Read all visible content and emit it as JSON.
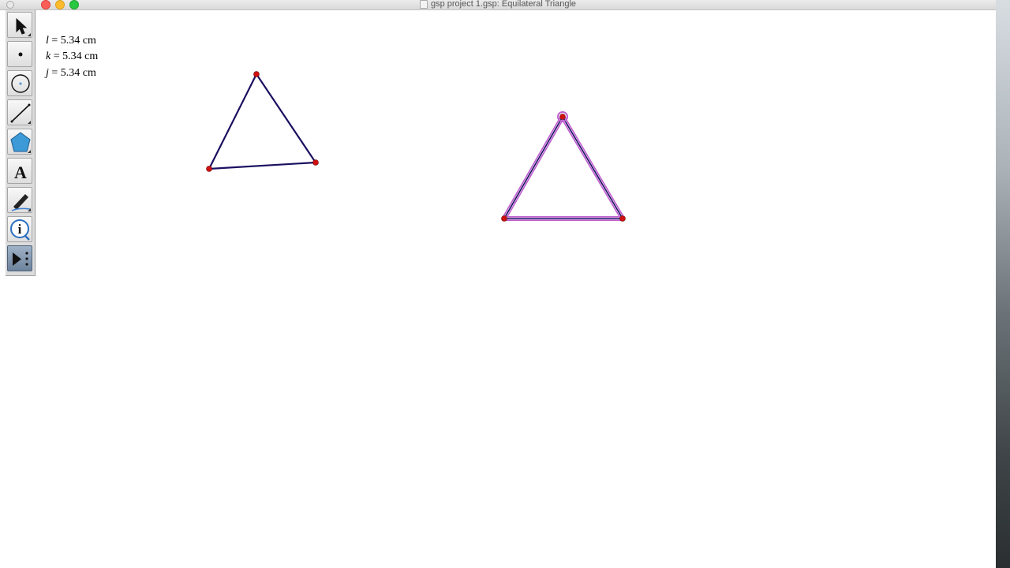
{
  "window": {
    "title": "gsp project 1.gsp: Equilateral Triangle"
  },
  "toolbox": {
    "tools": [
      {
        "name": "arrow-tool",
        "icon": "arrow-icon"
      },
      {
        "name": "point-tool",
        "icon": "point-icon"
      },
      {
        "name": "compass-tool",
        "icon": "circle-icon"
      },
      {
        "name": "straightedge-tool",
        "icon": "segment-icon"
      },
      {
        "name": "polygon-tool",
        "icon": "pentagon-icon"
      },
      {
        "name": "text-tool",
        "icon": "text-A-icon",
        "label": "A"
      },
      {
        "name": "marker-tool",
        "icon": "marker-pen-icon"
      },
      {
        "name": "information-tool",
        "icon": "info-icon",
        "label": "i"
      },
      {
        "name": "custom-tool",
        "icon": "play-dots-icon"
      }
    ]
  },
  "measurements": [
    {
      "var": "l",
      "text": " = 5.34 cm"
    },
    {
      "var": "k",
      "text": " = 5.34 cm"
    },
    {
      "var": "j",
      "text": " = 5.34 cm"
    }
  ],
  "colors": {
    "segment": "#1a1060",
    "point": "#d01010",
    "selection_highlight": "#c060d0",
    "active_tool": "#6d839c"
  }
}
